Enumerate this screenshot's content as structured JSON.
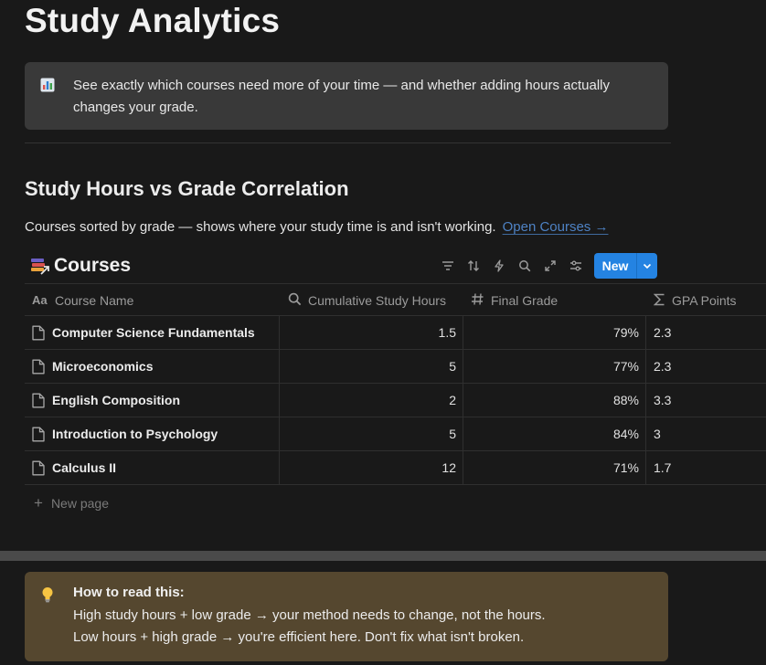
{
  "page": {
    "title": "Study Analytics"
  },
  "intro_callout": {
    "icon": "bar-chart-icon",
    "text": "See exactly which courses need more of your time — and whether adding hours actually changes your grade."
  },
  "section": {
    "heading": "Study Hours vs Grade Correlation",
    "subtitle": "Courses sorted by grade — shows where your study time is and isn't working.",
    "link_label": "Open Courses →"
  },
  "database": {
    "icon": "books-link-icon",
    "title": "Courses",
    "toolbar": {
      "icons": [
        "filter-icon",
        "sort-icon",
        "automation-icon",
        "search-icon",
        "expand-icon",
        "settings-icon"
      ],
      "new_label": "New"
    },
    "columns": [
      {
        "label": "Course Name",
        "icon": "title-property-icon"
      },
      {
        "label": "Cumulative Study Hours",
        "icon": "rollup-property-icon"
      },
      {
        "label": "Final Grade",
        "icon": "number-property-icon"
      },
      {
        "label": "GPA Points",
        "icon": "formula-property-icon"
      }
    ],
    "rows": [
      {
        "name": "Computer Science Fundamentals",
        "hours": "1.5",
        "grade": "79%",
        "gpa": "2.3"
      },
      {
        "name": "Microeconomics",
        "hours": "5",
        "grade": "77%",
        "gpa": "2.3"
      },
      {
        "name": "English Composition",
        "hours": "2",
        "grade": "88%",
        "gpa": "3.3"
      },
      {
        "name": "Introduction to Psychology",
        "hours": "5",
        "grade": "84%",
        "gpa": "3"
      },
      {
        "name": "Calculus II",
        "hours": "12",
        "grade": "71%",
        "gpa": "1.7"
      }
    ],
    "new_page_label": "New page"
  },
  "tip_callout": {
    "icon": "lightbulb-icon",
    "title": "How to read this:",
    "lines": [
      "High study hours + low grade → your method needs to change, not the hours.",
      "Low hours + high grade → you're efficient here. Don't fix what isn't broken."
    ]
  },
  "colors": {
    "background": "#191919",
    "intro_callout_bg": "#393939",
    "tip_callout_bg": "#55472f",
    "accent_blue": "#2483e2",
    "link": "#4e82c4"
  }
}
